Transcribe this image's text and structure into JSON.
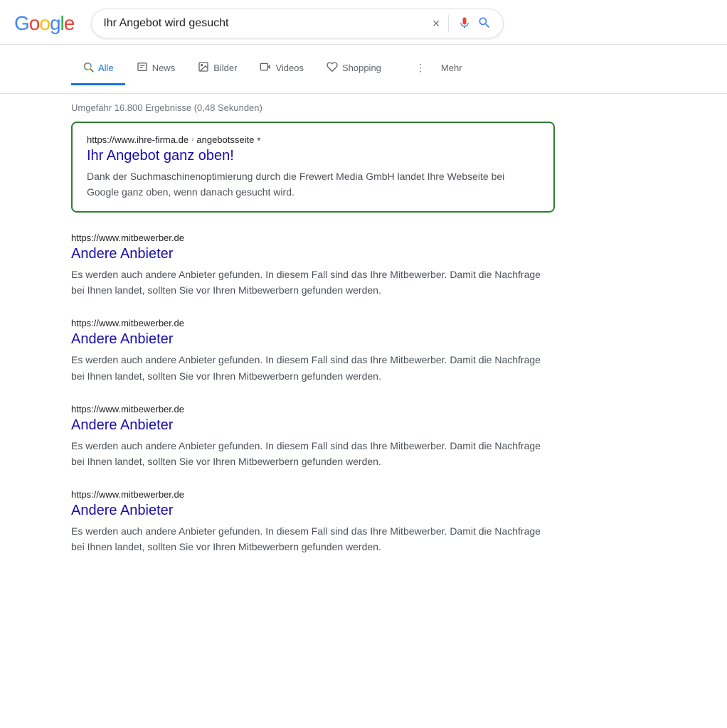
{
  "header": {
    "logo_letters": [
      "G",
      "o",
      "o",
      "g",
      "l",
      "e"
    ],
    "search_value": "Ihr Angebot wird gesucht",
    "clear_icon": "×",
    "mic_label": "Spracheingabe",
    "search_label": "Suche"
  },
  "nav": {
    "tabs": [
      {
        "id": "alle",
        "label": "Alle",
        "icon": "🔍",
        "active": true
      },
      {
        "id": "news",
        "label": "News",
        "icon": "📰",
        "active": false
      },
      {
        "id": "bilder",
        "label": "Bilder",
        "icon": "🖼",
        "active": false
      },
      {
        "id": "videos",
        "label": "Videos",
        "icon": "▶",
        "active": false
      },
      {
        "id": "shopping",
        "label": "Shopping",
        "icon": "◇",
        "active": false
      },
      {
        "id": "mehr",
        "label": "Mehr",
        "icon": "⋮",
        "active": false
      }
    ]
  },
  "results_info": "Umgefähr 16.800 Ergebnisse (0,48 Sekunden)",
  "featured_result": {
    "url": "https://www.ihre-firma.de",
    "url_path": "angebotsseite",
    "title": "Ihr Angebot ganz oben!",
    "snippet": "Dank der Suchmaschinenoptimierung durch die Frewert Media GmbH landet Ihre Webseite bei Google ganz oben, wenn danach gesucht wird."
  },
  "other_results": [
    {
      "url": "https://www.mitbewerber.de",
      "title": "Andere Anbieter",
      "snippet": "Es werden auch andere Anbieter gefunden. In diesem Fall sind das Ihre Mitbewerber. Damit die Nachfrage bei Ihnen landet, sollten Sie vor Ihren Mitbewerbern gefunden werden."
    },
    {
      "url": "https://www.mitbewerber.de",
      "title": "Andere Anbieter",
      "snippet": "Es werden auch andere Anbieter gefunden. In diesem Fall sind das Ihre Mitbewerber. Damit die Nachfrage bei Ihnen landet, sollten Sie vor Ihren Mitbewerbern gefunden werden."
    },
    {
      "url": "https://www.mitbewerber.de",
      "title": "Andere Anbieter",
      "snippet": "Es werden auch andere Anbieter gefunden. In diesem Fall sind das Ihre Mitbewerber. Damit die Nachfrage bei Ihnen landet, sollten Sie vor Ihren Mitbewerbern gefunden werden."
    },
    {
      "url": "https://www.mitbewerber.de",
      "title": "Andere Anbieter",
      "snippet": "Es werden auch andere Anbieter gefunden. In diesem Fall sind das Ihre Mitbewerber. Damit die Nachfrage bei Ihnen landet, sollten Sie vor Ihren Mitbewerbern gefunden werden."
    }
  ],
  "colors": {
    "featured_border": "#2e7d32",
    "link_color": "#1a0dab",
    "active_tab": "#1a73e8"
  }
}
